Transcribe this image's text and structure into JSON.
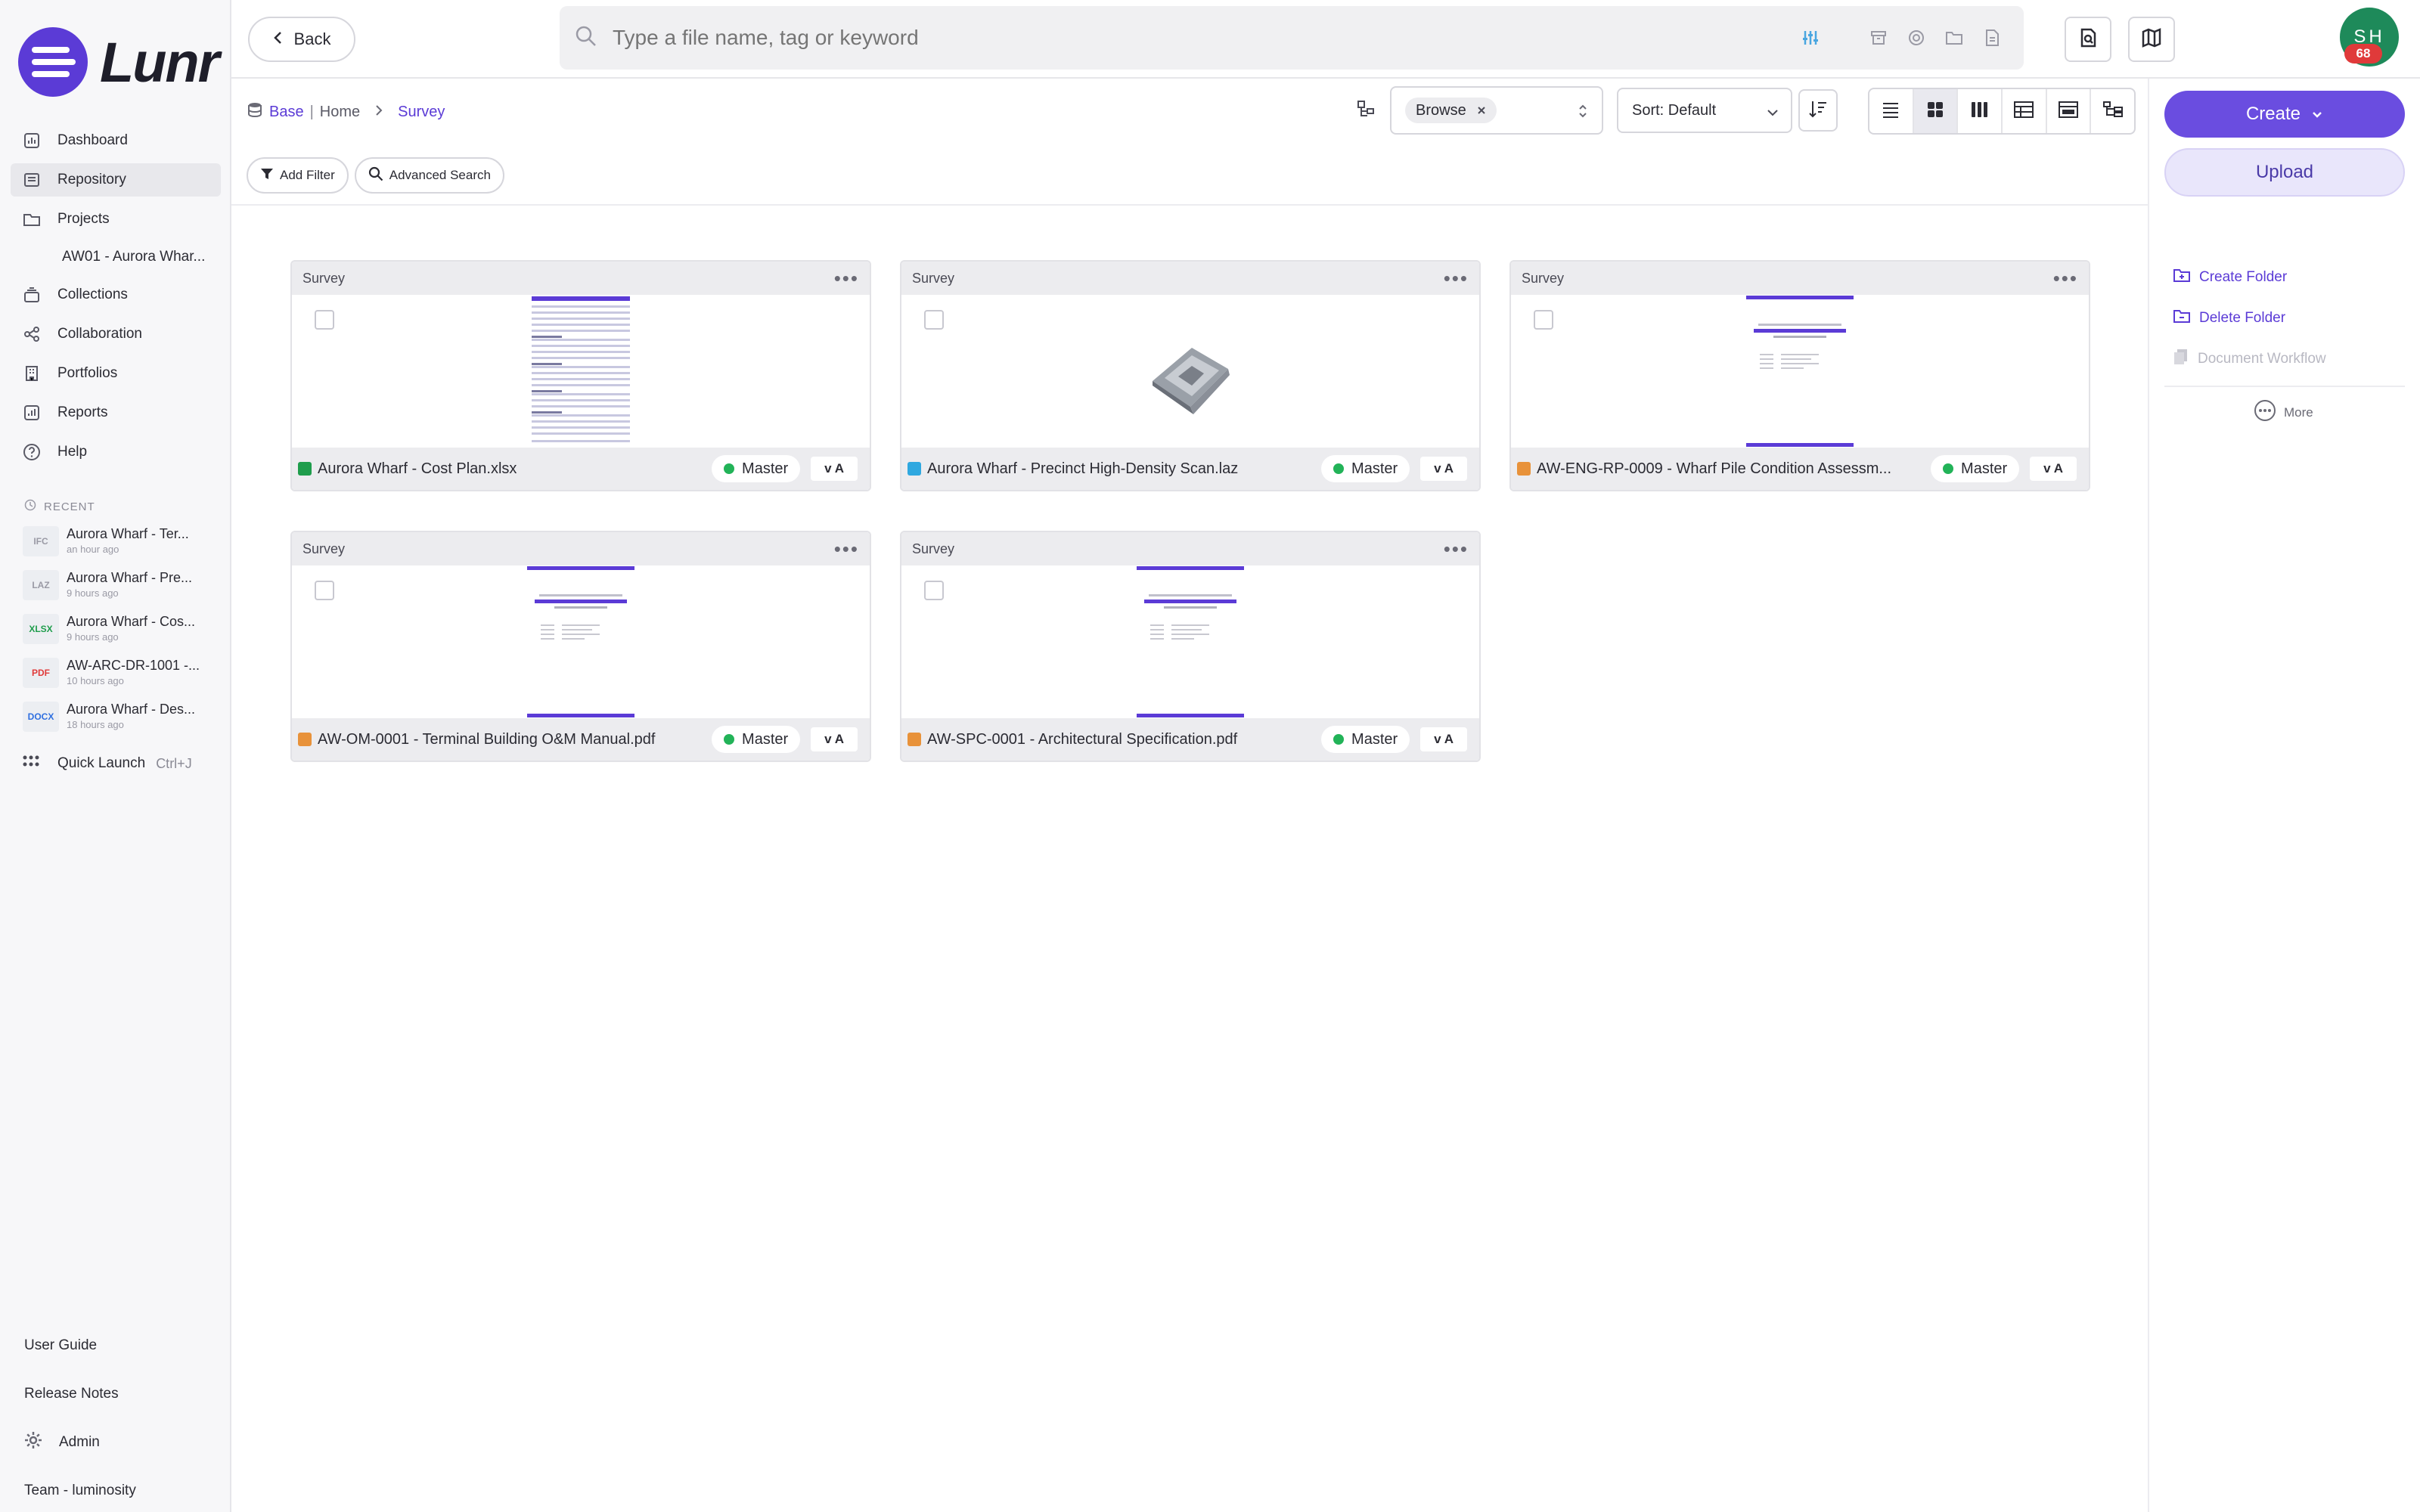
{
  "app": {
    "logo_text": "Lunr",
    "brand_color": "#5b3bd6"
  },
  "sidebar": {
    "items": [
      {
        "label": "Dashboard",
        "icon": "bar-chart-icon"
      },
      {
        "label": "Repository",
        "icon": "repository-icon",
        "active": true
      },
      {
        "label": "Projects",
        "icon": "folder-icon"
      },
      {
        "label": "Collections",
        "icon": "collections-icon"
      },
      {
        "label": "Collaboration",
        "icon": "share-icon"
      },
      {
        "label": "Portfolios",
        "icon": "building-icon"
      },
      {
        "label": "Reports",
        "icon": "report-icon"
      },
      {
        "label": "Help",
        "icon": "help-icon"
      }
    ],
    "project_sub": "AW01 - Aurora Whar...",
    "recent_heading": "RECENT",
    "recent": [
      {
        "type": "IFC",
        "type_color": "#9a9aa5",
        "name": "Aurora Wharf - Ter...",
        "time": "an hour ago"
      },
      {
        "type": "LAZ",
        "type_color": "#9a9aa5",
        "name": "Aurora Wharf - Pre...",
        "time": "9 hours ago"
      },
      {
        "type": "XLSX",
        "type_color": "#1f9d4c",
        "name": "Aurora Wharf - Cos...",
        "time": "9 hours ago"
      },
      {
        "type": "PDF",
        "type_color": "#e03a3a",
        "name": "AW-ARC-DR-1001 -...",
        "time": "10 hours ago"
      },
      {
        "type": "DOCX",
        "type_color": "#2f6fe0",
        "name": "Aurora Wharf - Des...",
        "time": "18 hours ago"
      }
    ],
    "quick_launch": "Quick Launch",
    "quick_launch_kbd": "Ctrl+J",
    "user_guide": "User Guide",
    "release_notes": "Release Notes",
    "admin": "Admin",
    "team": "Team - luminosity"
  },
  "topbar": {
    "back": "Back",
    "search_placeholder": "Type a file name, tag or keyword",
    "avatar_initials": "SH",
    "avatar_badge": "68"
  },
  "toolbar": {
    "breadcrumb_base": "Base",
    "breadcrumb_home": "Home",
    "breadcrumb_current": "Survey",
    "browse_chip": "Browse",
    "sort": "Sort: Default",
    "add_filter": "Add Filter",
    "advanced_search": "Advanced Search"
  },
  "right_panel": {
    "create": "Create",
    "upload": "Upload",
    "create_folder": "Create Folder",
    "delete_folder": "Delete Folder",
    "document_workflow": "Document Workflow",
    "more": "More"
  },
  "cards": [
    {
      "folder": "Survey",
      "name": "Aurora Wharf - Cost Plan.xlsx",
      "status": "Master",
      "version": "v A",
      "icon_color": "#1f9d4c",
      "thumb": "sheet"
    },
    {
      "folder": "Survey",
      "name": "Aurora Wharf - Precinct High-Density Scan.laz",
      "status": "Master",
      "version": "v A",
      "icon_color": "#2fa8e0",
      "thumb": "scan"
    },
    {
      "folder": "Survey",
      "name": "AW-ENG-RP-0009 - Wharf Pile Condition Assessm...",
      "status": "Master",
      "version": "v A",
      "icon_color": "#e8923a",
      "thumb": "doc"
    },
    {
      "folder": "Survey",
      "name": "AW-OM-0001 - Terminal Building O&M Manual.pdf",
      "status": "Master",
      "version": "v A",
      "icon_color": "#e8923a",
      "thumb": "doc"
    },
    {
      "folder": "Survey",
      "name": "AW-SPC-0001 - Architectural Specification.pdf",
      "status": "Master",
      "version": "v A",
      "icon_color": "#e8923a",
      "thumb": "doc"
    }
  ]
}
